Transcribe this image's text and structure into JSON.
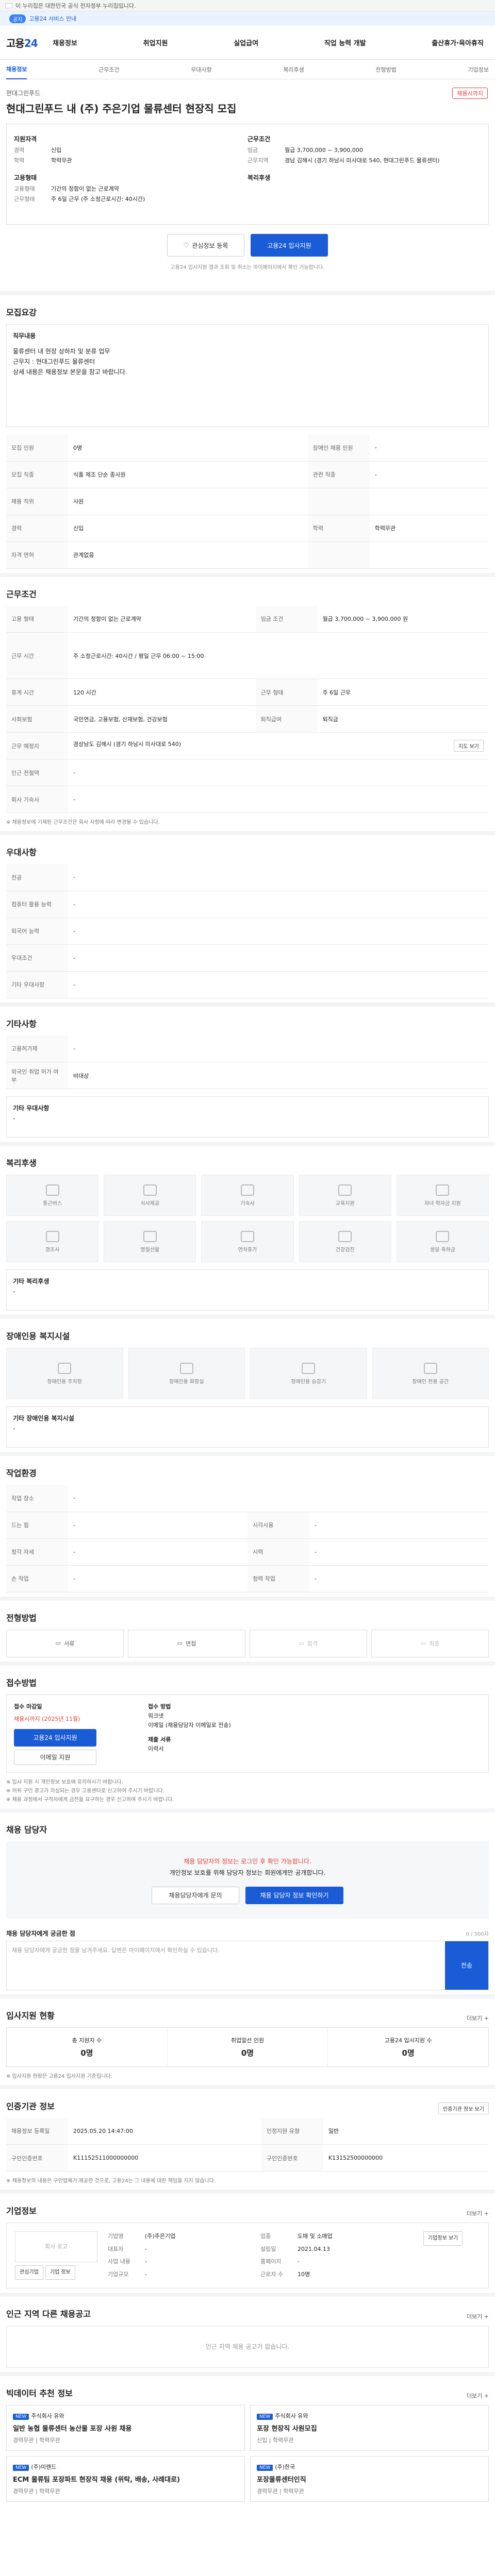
{
  "gov_bar": {
    "text": "이 누리집은 대한민국 공식 전자정부 누리집입니다."
  },
  "alert": {
    "pill": "공지",
    "text": "고용24 서비스 안내"
  },
  "header": {
    "logo_a": "고용",
    "logo_b": "24",
    "nav": [
      "채용정보",
      "취업지원",
      "실업급여",
      "직업 능력 개발",
      "출산휴가·육아휴직"
    ]
  },
  "subnav": {
    "items": [
      "채용정보",
      "근무조건",
      "우대사항",
      "복리후생",
      "전형방법",
      "기업정보"
    ],
    "active": 0
  },
  "job": {
    "company": "현대그린푸드",
    "title": "현대그린푸드 내 (주) 주은기업 물류센터 현장직 모집",
    "status": "채용시까지"
  },
  "summary": {
    "left_title": "지원자격",
    "left": [
      {
        "k": "경력",
        "v": "신입"
      },
      {
        "k": "학력",
        "v": "학력무관"
      }
    ],
    "left_title2": "고용형태",
    "left2": [
      {
        "k": "고용형태",
        "v": "기간의 정함이 없는 근로계약"
      },
      {
        "k": "근무형태",
        "v": "주 6일 근무 (주 소정근로시간: 40시간)"
      }
    ],
    "right_title": "근무조건",
    "right": [
      {
        "k": "임금",
        "v": "월급 3,700,000 ~ 3,900,000"
      },
      {
        "k": "근무지역",
        "v": "경남 김해시 (경기 하남시 미사대로 540, 현대그린푸드 물류센터)"
      }
    ],
    "right_title2": "복리후생",
    "right2": []
  },
  "actions": {
    "scrap": "관심정보 등록",
    "apply": "고용24 입사지원"
  },
  "actions_note": "고용24 입사지원 결과 조회 및 취소는 마이페이지에서 확인 가능합니다.",
  "recruit": {
    "title": "모집요강",
    "box_title": "직무내용",
    "box_lines": [
      "물류센터 내 현장 상하차 및 분류 업무",
      "근무지 : 현대그린푸드 물류센터",
      "상세 내용은 채용정보 본문을 참고 바랍니다."
    ],
    "rows": [
      [
        {
          "k": "모집 인원",
          "v": "0명"
        },
        {
          "k": "장애인 채용 인원",
          "v": "-"
        }
      ],
      [
        {
          "k": "모집 직종",
          "v": "식품 제조 단순 종사원"
        },
        {
          "k": "관련 직종",
          "v": "-"
        }
      ],
      [
        {
          "k": "채용 직위",
          "v": "사원"
        },
        {
          "k": "",
          "v": ""
        }
      ],
      [
        {
          "k": "경력",
          "v": "신입"
        },
        {
          "k": "학력",
          "v": "학력무관"
        }
      ],
      [
        {
          "k": "자격 면허",
          "v": "관계없음"
        },
        {
          "k": "",
          "v": ""
        }
      ]
    ]
  },
  "conditions": {
    "title": "근무조건",
    "rows": [
      [
        {
          "k": "고용 형태",
          "v": "기간의 정함이 없는 근로계약"
        },
        {
          "k": "임금 조건",
          "v": "월급 3,700,000 ~ 3,900,000 원"
        }
      ],
      [
        {
          "k": "근무 시간",
          "v": "주 소정근로시간: 40시간 / 평일 근무 06:00 ~ 15:00"
        },
        {
          "k": "",
          "v": ""
        }
      ],
      [
        {
          "k": "휴게 시간",
          "v": "120 시간"
        },
        {
          "k": "근무 형태",
          "v": "주 6일 근무"
        }
      ],
      [
        {
          "k": "사회보험",
          "v": "국민연금, 고용보험, 산재보험, 건강보험"
        },
        {
          "k": "퇴직급여",
          "v": "퇴직금"
        }
      ],
      [
        {
          "k": "근무 예정지",
          "v": "경상남도 김해시 (경기 하남시 미사대로 540)"
        },
        {
          "k": "",
          "v": ""
        }
      ],
      [
        {
          "k": "인근 전철역",
          "v": "-"
        },
        {
          "k": "",
          "v": ""
        }
      ],
      [
        {
          "k": "회사 기숙사",
          "v": "-"
        },
        {
          "k": "",
          "v": ""
        }
      ]
    ],
    "map_button": "지도 보기",
    "note": "※ 채용정보에 기재된 근무조건은 회사 사정에 따라 변경될 수 있습니다."
  },
  "prefer": {
    "title": "우대사항",
    "rows": [
      {
        "k": "전공",
        "v": "-"
      },
      {
        "k": "컴퓨터 활용 능력",
        "v": "-"
      },
      {
        "k": "외국어 능력",
        "v": "-"
      },
      {
        "k": "우대조건",
        "v": "-"
      },
      {
        "k": "기타 우대사항",
        "v": "-"
      }
    ]
  },
  "etc": {
    "title": "기타사항",
    "rows": [
      {
        "k": "고용허가제",
        "v": "-"
      },
      {
        "k": "외국인 취업 허가 여부",
        "v": "비대상"
      }
    ],
    "sub_title": "기타 우대사항",
    "sub_value": "-"
  },
  "welfare": {
    "title": "복리후생",
    "tiles": [
      "통근버스",
      "식사제공",
      "기숙사",
      "교육지원",
      "자녀 학자금 지원",
      "경조사",
      "명절선물",
      "연차휴가",
      "건강검진",
      "생일 축하금"
    ],
    "other_title": "기타 복리후생",
    "other_value": "-"
  },
  "disabled": {
    "title": "장애인용 복지시설",
    "tiles": [
      "장애인용 주차장",
      "장애인용 화장실",
      "장애인용 승강기",
      "장애인 전용 공간"
    ],
    "other_title": "기타 장애인용 복지시설",
    "other_value": "-"
  },
  "environment": {
    "title": "작업환경",
    "rows": [
      [
        {
          "k": "작업 장소",
          "v": "-"
        },
        {
          "k": "",
          "v": ""
        }
      ],
      [
        {
          "k": "드는 힘",
          "v": "-"
        },
        {
          "k": "시각사용",
          "v": "-"
        }
      ],
      [
        {
          "k": "청각 자세",
          "v": "-"
        },
        {
          "k": "시력",
          "v": "-"
        }
      ],
      [
        {
          "k": "손 작업",
          "v": "-"
        },
        {
          "k": "청력 작업",
          "v": "-"
        }
      ]
    ]
  },
  "selection": {
    "title": "전형방법",
    "steps": [
      "서류",
      "면접",
      "합격",
      "최종"
    ]
  },
  "apply": {
    "title": "접수방법",
    "left_title": "접수 마감일",
    "deadline": "채용시까지 (2025년 11월)",
    "apply_btn": "고용24 입사지원",
    "left_btn": "이메일 지원",
    "right_title": "접수 방법",
    "methods": [
      "워크넷",
      "이메일 (채용담당자 이메일로 전송)"
    ],
    "doc_title": "제출 서류",
    "doc_value": "이력서",
    "docs_label": "",
    "warns": [
      "※ 입사 지원 시 개인정보 보호에 유의하시기 바랍니다.",
      "※ 허위 구인 광고가 의심되는 경우 고용센터로 신고하여 주시기 바랍니다.",
      "※ 채용 과정에서 구직자에게 금전을 요구하는 경우 신고하여 주시기 바랍니다."
    ]
  },
  "contact": {
    "title": "채용 담당자",
    "line1": "채용 담당자의 정보는 로그인 후 확인 가능합니다.",
    "line2": "개인정보 보호를 위해 담당자 정보는 회원에게만 공개합니다.",
    "btn1": "채용담당자에게 문의",
    "btn2": "채용 담당자 정보 확인하기",
    "qna_title": "채용 담당자에게 궁금한 점",
    "qna_hint": "채용 담당자에게 궁금한 점을 남겨주세요. 답변은 마이페이지에서 확인하실 수 있습니다.",
    "send": "전송",
    "count": "0 / 500자"
  },
  "status": {
    "title": "입사지원 현황",
    "more": "더보기 +",
    "items": [
      {
        "label": "총 지원자 수",
        "value": "0명"
      },
      {
        "label": "취업알선 인원",
        "value": "0명"
      },
      {
        "label": "고용24 입사지원 수",
        "value": "0명"
      }
    ],
    "note": "※ 입사지원 현황은 고용24 입사지원 기준입니다."
  },
  "info": {
    "title": "인증기관 정보",
    "btn": "인증기관 정보 보기",
    "rows": [
      [
        {
          "k": "채용정보 등록일",
          "v": "2025.05.20 14:47:00"
        },
        {
          "k": "인정지원 유형",
          "v": "일반"
        },
        {
          "k": "",
          "v": "-"
        }
      ],
      [
        {
          "k": "구인인증번호",
          "v": "K11152511000000000"
        },
        {
          "k": "구인인증번호",
          "v": "K13152500000000"
        },
        {
          "k": "",
          "v": ""
        }
      ]
    ],
    "warns": [
      "※ 채용정보의 내용은 구인업체가 제공한 것으로, 고용24는 그 내용에 대한 책임을 지지 않습니다."
    ]
  },
  "company": {
    "title": "기업정보",
    "more": "더보기 +",
    "logo_text": "회사 로고",
    "btns": [
      "관심기업",
      "기업 정보"
    ],
    "rows": [
      [
        {
          "k": "기업명",
          "v": "(주)주은기업"
        },
        {
          "k": "업종",
          "v": "도매 및 소매업"
        }
      ],
      [
        {
          "k": "대표자",
          "v": "-"
        },
        {
          "k": "설립일",
          "v": "2021.04.13"
        }
      ],
      [
        {
          "k": "사업 내용",
          "v": "-"
        },
        {
          "k": "홈페이지",
          "v": "-"
        }
      ],
      [
        {
          "k": "기업규모",
          "v": "-"
        },
        {
          "k": "근로자 수",
          "v": "10명"
        }
      ]
    ],
    "btn_right": "기업정보 보기"
  },
  "similar": {
    "title": "인근 지역 다른 채용공고",
    "more": "더보기 +",
    "empty": "인근 지역 채용 공고가 없습니다."
  },
  "ai": {
    "title": "빅데이터 추천 정보",
    "more": "더보기 +",
    "cards": [
      {
        "tag": "NEW",
        "company": "주식회사 유와",
        "title": "일반 농협 물류센터 농산물 포장 사원 채용",
        "meta": "경력무관  |  학력무관"
      },
      {
        "tag": "NEW",
        "company": "주식회사 유와",
        "title": "포장 현장직 사원모집",
        "meta": "신입  |  학력무관"
      },
      {
        "tag": "NEW",
        "company": "(주)이랜드",
        "title": "ECM 물류팀 포장파트 현장직 채용 (위탁, 배송, 사례대로)",
        "meta": "경력무관  |  학력무관"
      },
      {
        "tag": "NEW",
        "company": "(주)한국",
        "title": "포장물류센터인직",
        "meta": "경력무관  |  학력무관"
      }
    ]
  }
}
